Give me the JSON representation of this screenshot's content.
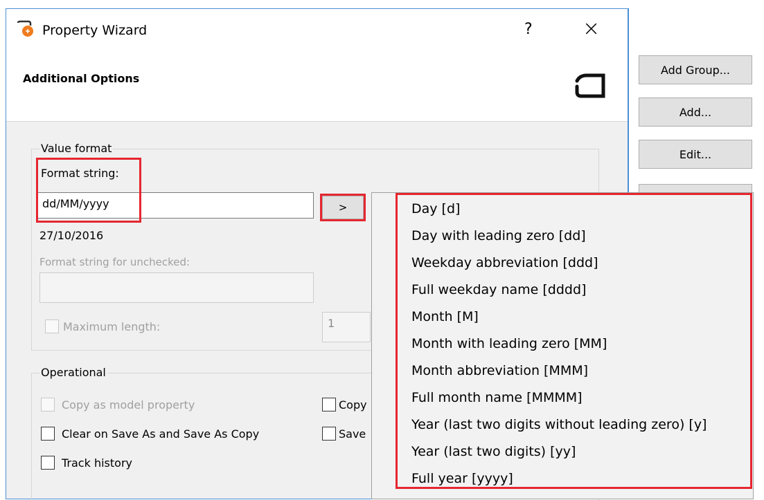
{
  "dialog": {
    "title": "Property Wizard",
    "help_glyph": "?",
    "close_glyph": "×",
    "icon": "wizard-app-icon",
    "header_title": "Additional Options",
    "logo": "brand-hook-logo"
  },
  "background_app": {
    "buttons": [
      "Add Group...",
      "Add...",
      "Edit..."
    ]
  },
  "value_format": {
    "group_label": "Value format",
    "format_label": "Format string:",
    "format_value": "dd/MM/yyyy",
    "insert_button": ">",
    "preview": "27/10/2016",
    "unchecked_label": "Format string for unchecked:",
    "unchecked_value": "",
    "max_length_label": "Maximum length:",
    "max_length_value": "1"
  },
  "operational": {
    "group_label": "Operational",
    "copy_model": "Copy as model property",
    "clear_on_save": "Clear on Save As and Save As Copy",
    "track_history": "Track history",
    "copy_partial": "Copy",
    "save_partial": "Save"
  },
  "format_menu": {
    "items": [
      "Day [d]",
      "Day with leading zero [dd]",
      "Weekday abbreviation [ddd]",
      "Full weekday name [dddd]",
      "Month [M]",
      "Month with leading zero [MM]",
      "Month abbreviation [MMM]",
      "Full month name [MMMM]",
      "Year (last two digits without leading zero) [y]",
      "Year (last two digits) [yy]",
      "Full year [yyyy]"
    ]
  },
  "colors": {
    "highlight": "#e6262f",
    "dialog_border": "#4a8fd4",
    "icon_orange": "#f07c1e"
  }
}
